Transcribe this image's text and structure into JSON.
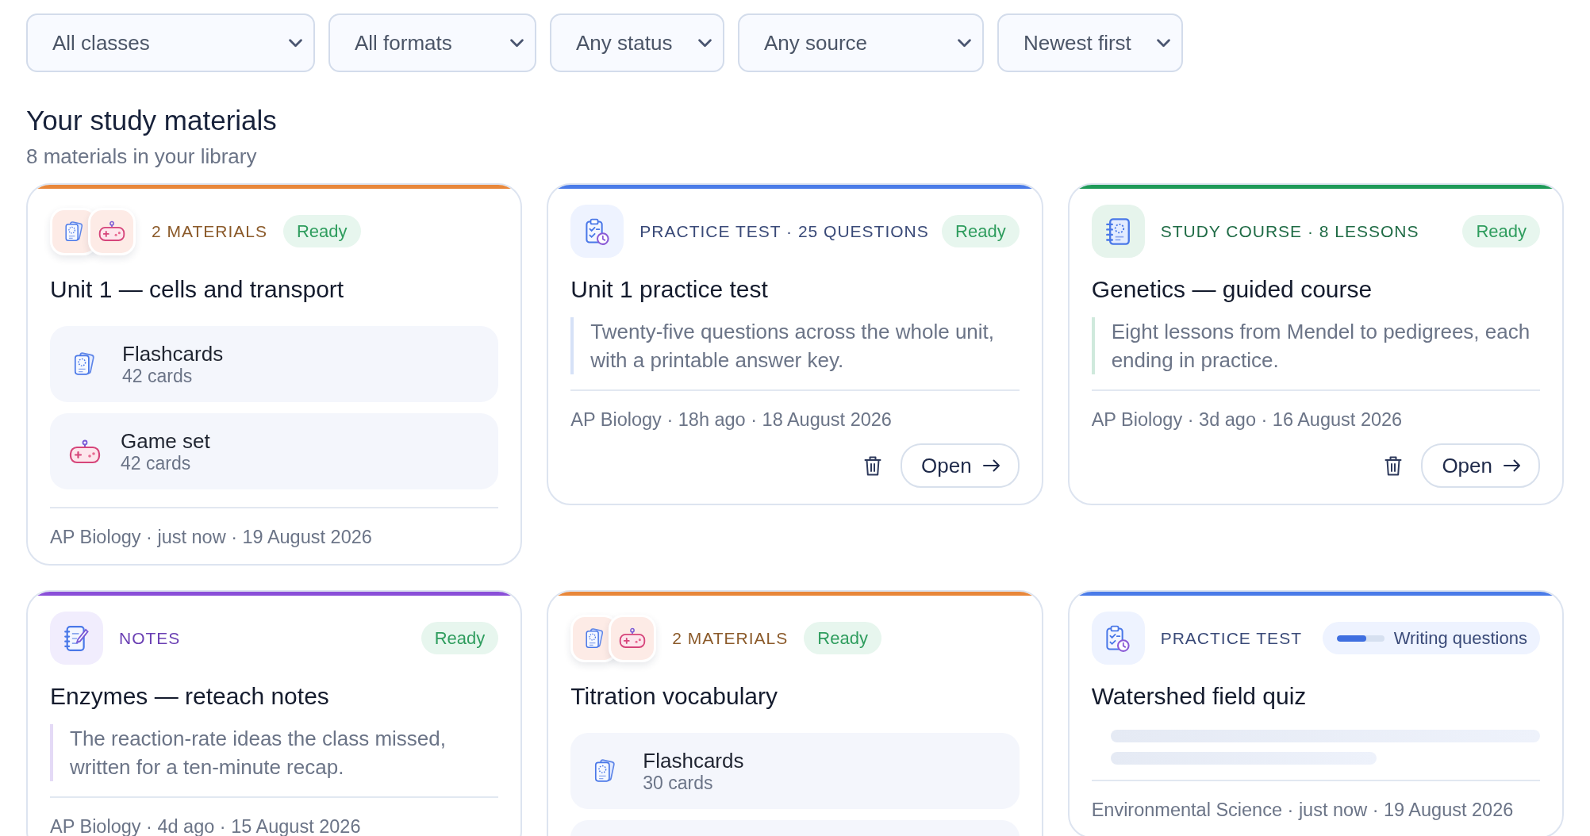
{
  "filters": [
    {
      "value": "All classes"
    },
    {
      "value": "All formats"
    },
    {
      "value": "Any status"
    },
    {
      "value": "Any source"
    },
    {
      "value": "Newest first"
    }
  ],
  "library": {
    "title": "Your study materials",
    "subtitle": "8 materials in your library"
  },
  "cards": [
    {
      "kind": "bundle",
      "type_label": "2 MATERIALS",
      "status": {
        "kind": "ready",
        "label": "Ready"
      },
      "title": "Unit 1 — cells and transport",
      "items": [
        {
          "kind": "flashcards",
          "title": "Flashcards",
          "count": "42 cards"
        },
        {
          "kind": "game",
          "title": "Game set",
          "count": "42 cards"
        }
      ],
      "meta": "AP Biology · just now · 19 August 2026"
    },
    {
      "kind": "practice_test",
      "type_label": "PRACTICE TEST · 25 QUESTIONS",
      "status": {
        "kind": "ready",
        "label": "Ready"
      },
      "title": "Unit 1 practice test",
      "description": "Twenty-five questions across the whole unit, with a printable answer key.",
      "meta": "AP Biology · 18h ago · 18 August 2026",
      "actions": {
        "open_label": "Open"
      }
    },
    {
      "kind": "study_course",
      "type_label": "STUDY COURSE · 8 LESSONS",
      "status": {
        "kind": "ready",
        "label": "Ready"
      },
      "title": "Genetics — guided course",
      "description": "Eight lessons from Mendel to pedigrees, each ending in practice.",
      "meta": "AP Biology · 3d ago · 16 August 2026",
      "actions": {
        "open_label": "Open"
      }
    },
    {
      "kind": "notes",
      "type_label": "NOTES",
      "status": {
        "kind": "ready",
        "label": "Ready"
      },
      "title": "Enzymes — reteach notes",
      "description": "The reaction-rate ideas the class missed, written for a ten-minute recap.",
      "meta": "AP Biology · 4d ago · 15 August 2026"
    },
    {
      "kind": "bundle",
      "type_label": "2 MATERIALS",
      "status": {
        "kind": "ready",
        "label": "Ready"
      },
      "title": "Titration vocabulary",
      "items": [
        {
          "kind": "flashcards",
          "title": "Flashcards",
          "count": "30 cards"
        },
        {
          "kind": "game"
        }
      ]
    },
    {
      "kind": "practice_test",
      "type_label": "PRACTICE TEST",
      "status": {
        "kind": "generating",
        "label": "Writing questions",
        "level": 0.63
      },
      "title": "Watershed field quiz",
      "meta": "Environmental Science · just now · 19 August 2026"
    }
  ]
}
